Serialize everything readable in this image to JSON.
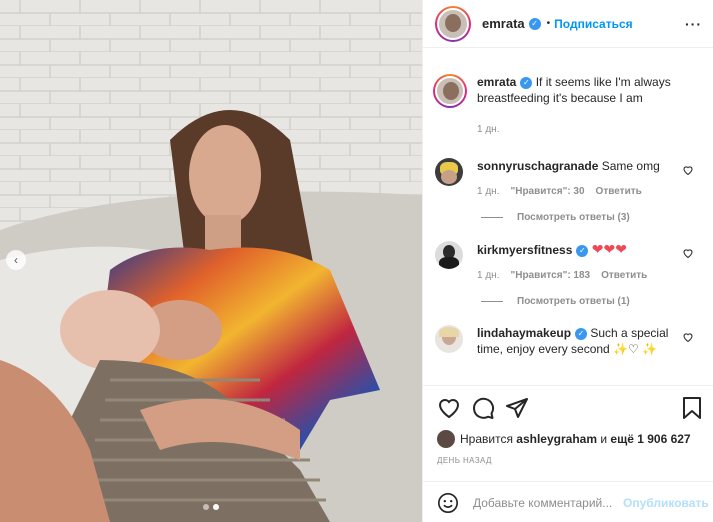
{
  "header": {
    "username": "emrata",
    "separator": "•",
    "follow_label": "Подписаться",
    "more_label": "···"
  },
  "caption": {
    "username": "emrata",
    "text": "If it seems like I'm always breastfeeding it's because I am",
    "time": "1 дн."
  },
  "comments": [
    {
      "username": "sonnyruschagranade",
      "text": "Same omg",
      "time": "1 дн.",
      "likes": "\"Нравится\": 30",
      "reply_label": "Ответить",
      "view_replies": "Посмотреть ответы (3)"
    },
    {
      "username": "kirkmyersfitness",
      "text": "❤❤❤",
      "time": "1 дн.",
      "likes": "\"Нравится\": 183",
      "reply_label": "Ответить",
      "view_replies": "Посмотреть ответы (1)"
    },
    {
      "username": "lindahaymakeup",
      "text": "Such a special time, enjoy every second ✨♡ ✨"
    }
  ],
  "likes": {
    "prefix": "Нравится",
    "user": "ashleygraham",
    "mid": "и",
    "count": "ещё 1 906 627"
  },
  "date": "ДЕНЬ НАЗАД",
  "add_comment": {
    "placeholder": "Добавьте комментарий...",
    "publish_label": "Опубликовать"
  },
  "carousel": {
    "prev_label": "‹",
    "active_index": 1,
    "total": 2
  },
  "colors": {
    "accent": "#0095f6",
    "verified": "#3897f0",
    "heart": "#ed4956"
  }
}
